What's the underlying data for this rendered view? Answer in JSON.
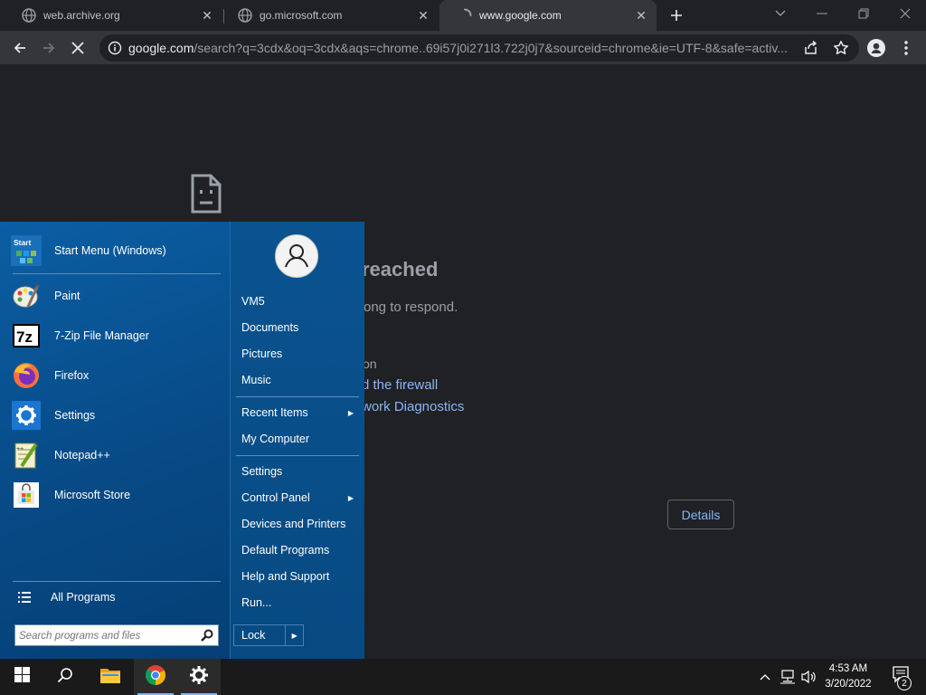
{
  "browser": {
    "tabs": [
      {
        "title": "web.archive.org",
        "favicon": "globe-icon",
        "active": false
      },
      {
        "title": "go.microsoft.com",
        "favicon": "globe-icon",
        "active": false
      },
      {
        "title": "www.google.com",
        "favicon": "loading-spinner-icon",
        "active": true
      }
    ],
    "address": {
      "host": "google.com",
      "path": "/search?q=3cdx&oq=3cdx&aqs=chrome..69i57j0i271l3.722j0j7&sourceid=chrome&ie=UTF-8&safe=activ..."
    }
  },
  "error_page": {
    "heading_fragment": "reached",
    "subtitle_fragment": "ong to respond.",
    "try_fragment": "on",
    "firewall_link_fragment": "d the firewall",
    "diagnostics_link_fragment": "work Diagnostics",
    "details_button": "Details"
  },
  "start_menu": {
    "pinned": [
      {
        "label": "Start Menu (Windows)",
        "icon": "start-menu-app-icon"
      },
      {
        "label": "Paint",
        "icon": "paint-icon"
      },
      {
        "label": "7-Zip File Manager",
        "icon": "7zip-icon"
      },
      {
        "label": "Firefox",
        "icon": "firefox-icon"
      },
      {
        "label": "Settings",
        "icon": "settings-gear-icon"
      },
      {
        "label": "Notepad++",
        "icon": "notepad-plus-plus-icon"
      },
      {
        "label": "Microsoft Store",
        "icon": "microsoft-store-icon"
      }
    ],
    "start_app_icon_text": "Start",
    "all_programs": "All Programs",
    "search_placeholder": "Search programs and files",
    "user_name": "VM5",
    "right_items": {
      "documents": "Documents",
      "pictures": "Pictures",
      "music": "Music",
      "recent_items": "Recent Items",
      "my_computer": "My Computer",
      "settings": "Settings",
      "control_panel": "Control Panel",
      "devices_printers": "Devices and Printers",
      "default_programs": "Default Programs",
      "help_support": "Help and Support",
      "run": "Run..."
    },
    "lock_label": "Lock"
  },
  "taskbar": {
    "time": "4:53 AM",
    "date": "3/20/2022",
    "notification_count": "2",
    "pinned": [
      "windows-start-icon",
      "search-icon",
      "file-explorer-icon",
      "chrome-icon",
      "settings-gear-icon"
    ]
  },
  "colors": {
    "page_bg": "#202124",
    "link": "#8ab4f8",
    "start_menu_blue": "#0a4f8a",
    "taskbar": "#1a1a1a"
  }
}
